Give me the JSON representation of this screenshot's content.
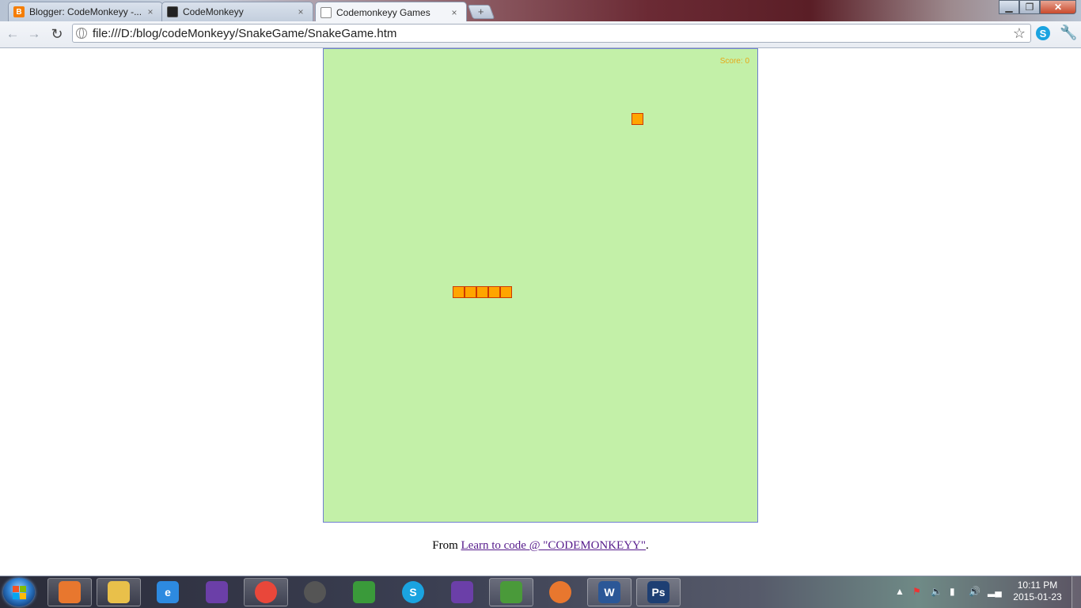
{
  "browser": {
    "tabs": [
      {
        "label": "Blogger: CodeMonkeyy -...",
        "favicon": "blogger-icon",
        "active": false
      },
      {
        "label": "CodeMonkeyy",
        "favicon": "monkey-icon",
        "active": false
      },
      {
        "label": "Codemonkeyy Games",
        "favicon": "page-icon",
        "active": true
      }
    ],
    "tab_close_glyph": "×",
    "new_tab_glyph": "+",
    "url": "file:///D:/blog/codeMonkeyy/SnakeGame/SnakeGame.htm",
    "window_controls": {
      "minimize": "▁",
      "maximize": "❐",
      "close": "✕"
    }
  },
  "game": {
    "score_label": "Score:",
    "score_value": "0",
    "grid_cell_count": {
      "columns": 36,
      "rows": 40
    },
    "food": {
      "col": 25,
      "row": 5
    },
    "snake": [
      {
        "col": 10,
        "row": 20
      },
      {
        "col": 11,
        "row": 20
      },
      {
        "col": 12,
        "row": 20
      },
      {
        "col": 13,
        "row": 20
      },
      {
        "col": 14,
        "row": 20
      }
    ],
    "colors": {
      "board": "#c3f0a8",
      "cell_fill": "#ffa500",
      "cell_border": "#cc3a00",
      "score": "#e6a817"
    }
  },
  "footer": {
    "prefix": "From ",
    "link_text": "Learn to code @ \"CODEMONKEYY\"",
    "suffix": "."
  },
  "taskbar": {
    "apps": [
      {
        "name": "media-player-icon",
        "label": ""
      },
      {
        "name": "explorer-icon",
        "label": ""
      },
      {
        "name": "internet-explorer-icon",
        "label": "e"
      },
      {
        "name": "visual-studio-icon",
        "label": ""
      },
      {
        "name": "chrome-icon",
        "label": ""
      },
      {
        "name": "recorder-icon",
        "label": ""
      },
      {
        "name": "windows-logo-icon",
        "label": ""
      },
      {
        "name": "skype-icon",
        "label": "S"
      },
      {
        "name": "visual-studio-2-icon",
        "label": ""
      },
      {
        "name": "dreamweaver-icon",
        "label": ""
      },
      {
        "name": "firefox-icon",
        "label": ""
      },
      {
        "name": "word-icon",
        "label": "W"
      },
      {
        "name": "photoshop-icon",
        "label": "Ps"
      }
    ],
    "clock_time": "10:11 PM",
    "clock_date": "2015-01-23"
  }
}
